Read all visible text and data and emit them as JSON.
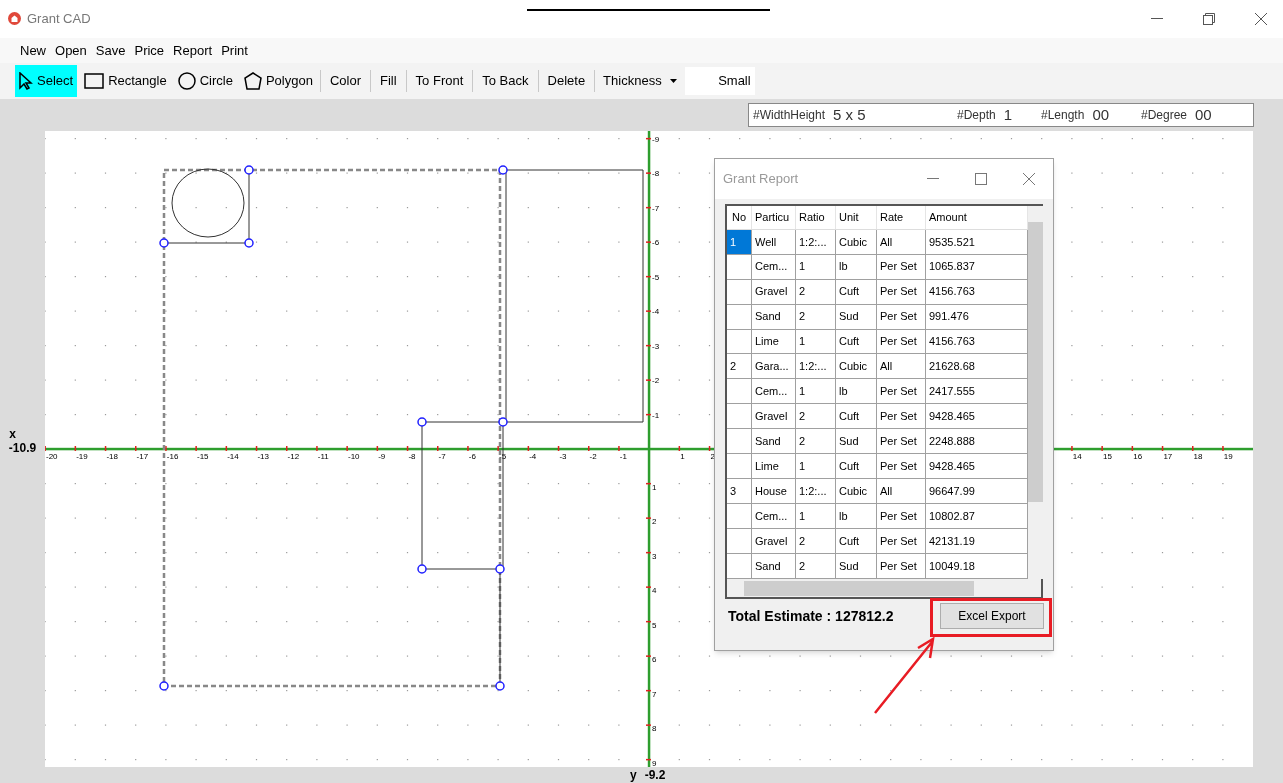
{
  "window": {
    "title": "Grant CAD"
  },
  "menu": [
    "New",
    "Open",
    "Save",
    "Price",
    "Report",
    "Print"
  ],
  "toolbar": [
    {
      "kind": "tool",
      "label": "Select",
      "selected": true
    },
    {
      "kind": "tool",
      "label": "Rectangle",
      "selected": false
    },
    {
      "kind": "tool",
      "label": "Circle",
      "selected": false
    },
    {
      "kind": "tool",
      "label": "Polygon",
      "selected": false
    },
    {
      "kind": "button",
      "label": "Color"
    },
    {
      "kind": "button",
      "label": "Fill"
    },
    {
      "kind": "button",
      "label": "To Front"
    },
    {
      "kind": "button",
      "label": "To Back"
    },
    {
      "kind": "button",
      "label": "Delete"
    },
    {
      "kind": "dropdown",
      "label": "Thickness"
    },
    {
      "kind": "value",
      "label": "Small"
    }
  ],
  "info_bar": [
    {
      "label": "#WidthHeight",
      "value": "5 x 5"
    },
    {
      "label": "#Depth",
      "value": "1"
    },
    {
      "label": "#Length",
      "value": "00"
    },
    {
      "label": "#Degree",
      "value": "00"
    }
  ],
  "axes": {
    "x_label": "x",
    "x_value": "-10.9",
    "y_label": "y",
    "y_value": "-9.2",
    "x_ticks_negative": [
      "-20",
      "-19",
      "-18",
      "-17",
      "-16",
      "-15",
      "-14",
      "-13",
      "-12",
      "-11",
      "-10",
      "-9",
      "-8",
      "-7",
      "-6",
      "-5",
      "-4",
      "-3",
      "-2",
      "-1"
    ],
    "x_ticks_positive": [
      "1",
      "2"
    ],
    "x_ticks_far": [
      "14",
      "15",
      "16",
      "17",
      "18",
      "19"
    ],
    "y_ticks_negative": [
      "-9",
      "-8",
      "-7",
      "-6",
      "-5",
      "-4",
      "-3",
      "-2",
      "-1"
    ],
    "y_ticks_positive": [
      "1",
      "2",
      "3",
      "4",
      "5",
      "6",
      "7",
      "8",
      "9"
    ]
  },
  "report": {
    "title": "Grant Report",
    "columns": [
      "No",
      "Particu",
      "Ratio",
      "Unit",
      "Rate",
      "Amount"
    ],
    "rows": [
      {
        "cells": [
          "1",
          "Well",
          "1:2:...",
          "Cubic",
          "All",
          "9535.521"
        ],
        "selected": true
      },
      {
        "cells": [
          "",
          "Cem...",
          "1",
          "lb",
          "Per Set",
          "1065.837"
        ],
        "selected": false
      },
      {
        "cells": [
          "",
          "Gravel",
          "2",
          "Cuft",
          "Per Set",
          "4156.763"
        ],
        "selected": false
      },
      {
        "cells": [
          "",
          "Sand",
          "2",
          "Sud",
          "Per Set",
          "991.476"
        ],
        "selected": false
      },
      {
        "cells": [
          "",
          "Lime",
          "1",
          "Cuft",
          "Per Set",
          "4156.763"
        ],
        "selected": false
      },
      {
        "cells": [
          "2",
          "Gara...",
          "1:2:...",
          "Cubic",
          "All",
          "21628.68"
        ],
        "selected": false
      },
      {
        "cells": [
          "",
          "Cem...",
          "1",
          "lb",
          "Per Set",
          "2417.555"
        ],
        "selected": false
      },
      {
        "cells": [
          "",
          "Gravel",
          "2",
          "Cuft",
          "Per Set",
          "9428.465"
        ],
        "selected": false
      },
      {
        "cells": [
          "",
          "Sand",
          "2",
          "Sud",
          "Per Set",
          "2248.888"
        ],
        "selected": false
      },
      {
        "cells": [
          "",
          "Lime",
          "1",
          "Cuft",
          "Per Set",
          "9428.465"
        ],
        "selected": false
      },
      {
        "cells": [
          "3",
          "House",
          "1:2:...",
          "Cubic",
          "All",
          "96647.99"
        ],
        "selected": false
      },
      {
        "cells": [
          "",
          "Cem...",
          "1",
          "lb",
          "Per Set",
          "10802.87"
        ],
        "selected": false
      },
      {
        "cells": [
          "",
          "Gravel",
          "2",
          "Cuft",
          "Per Set",
          "42131.19"
        ],
        "selected": false
      },
      {
        "cells": [
          "",
          "Sand",
          "2",
          "Sud",
          "Per Set",
          "10049.18"
        ],
        "selected": false
      }
    ],
    "total": "Total Estimate : 127812.2",
    "export_button": "Excel Export"
  }
}
